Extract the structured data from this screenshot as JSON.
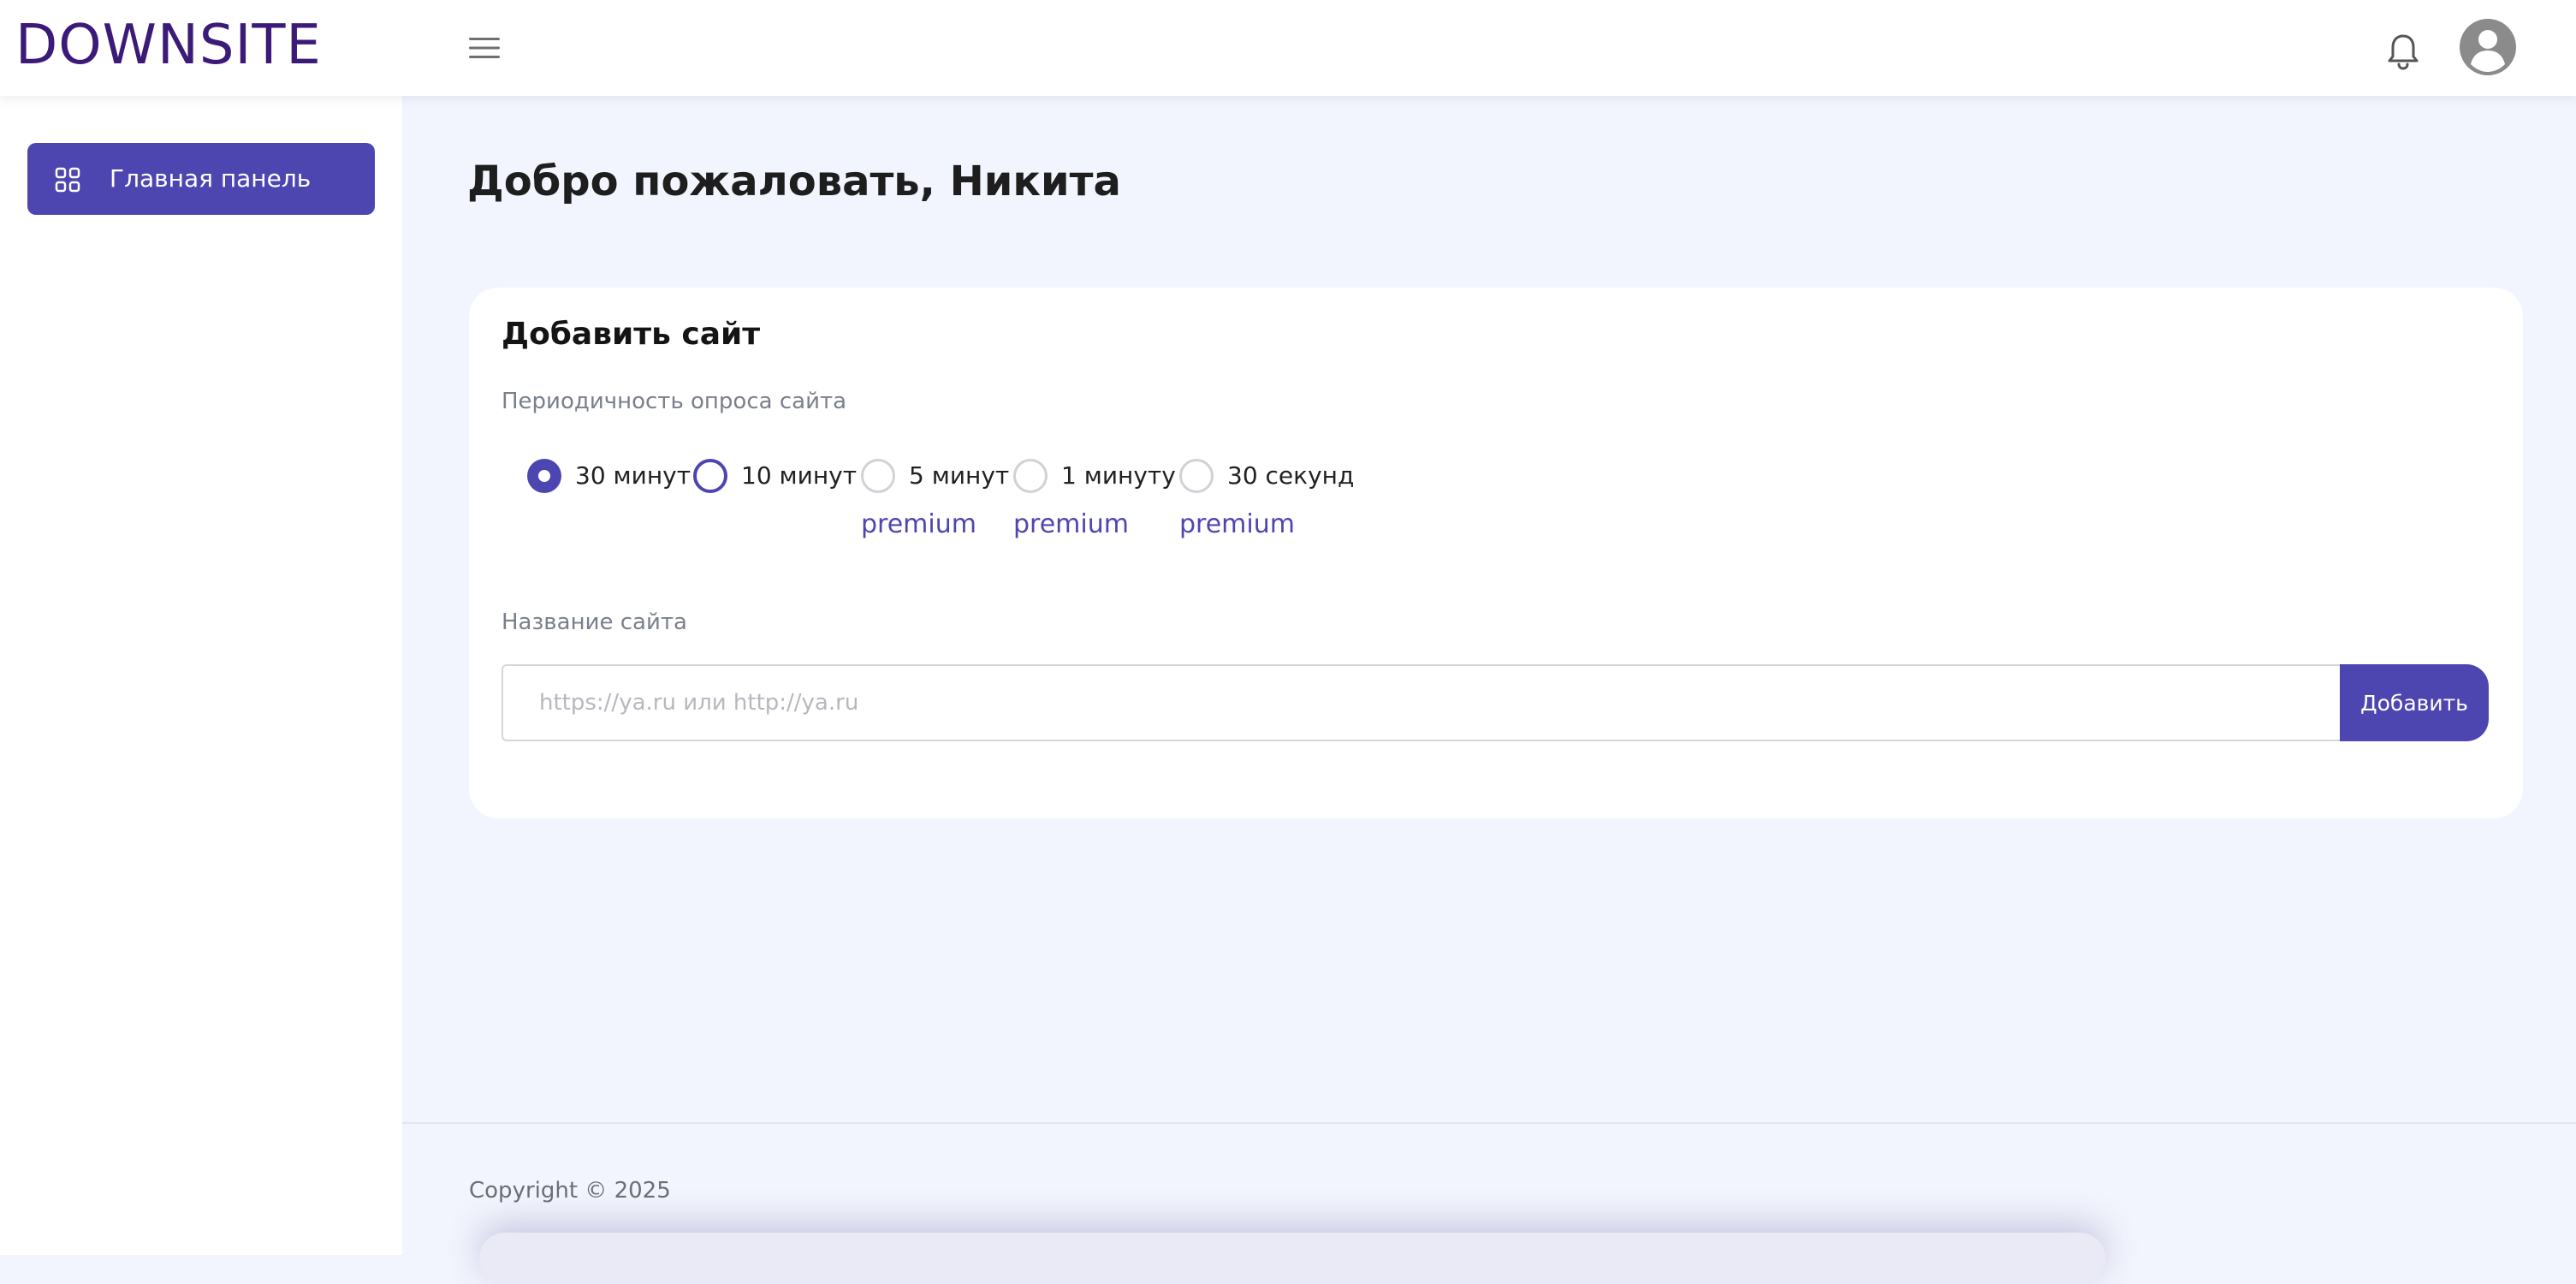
{
  "header": {
    "logo": "DOWNSITE",
    "menu_icon": "hamburger-menu-icon",
    "notifications_icon": "bell-icon",
    "profile_icon": "user-avatar-icon"
  },
  "sidebar": {
    "items": [
      {
        "label": "Главная панель",
        "icon": "grid-icon",
        "active": true
      }
    ]
  },
  "main": {
    "title": "Добро пожаловать, Никита",
    "add_site": {
      "title": "Добавить сайт",
      "frequency_label": "Периодичность опроса сайта",
      "frequency_options": [
        {
          "label": "30 минут",
          "selected": true,
          "premium": false
        },
        {
          "label": "10 минут",
          "selected": false,
          "premium": false
        },
        {
          "label": "5 минут",
          "selected": false,
          "premium": true
        },
        {
          "label": "1 минуту",
          "selected": false,
          "premium": true
        },
        {
          "label": "30 секунд",
          "selected": false,
          "premium": true
        }
      ],
      "premium_label": "premium",
      "name_label": "Название сайта",
      "url_placeholder": "https://ya.ru или http://ya.ru",
      "url_value": "",
      "add_button": "Добавить"
    }
  },
  "footer": {
    "copyright": "Copyright © 2025"
  },
  "colors": {
    "accent": "#4e46b0",
    "logo": "#3c1a78",
    "background": "#f2f5fd",
    "card": "#ffffff"
  }
}
